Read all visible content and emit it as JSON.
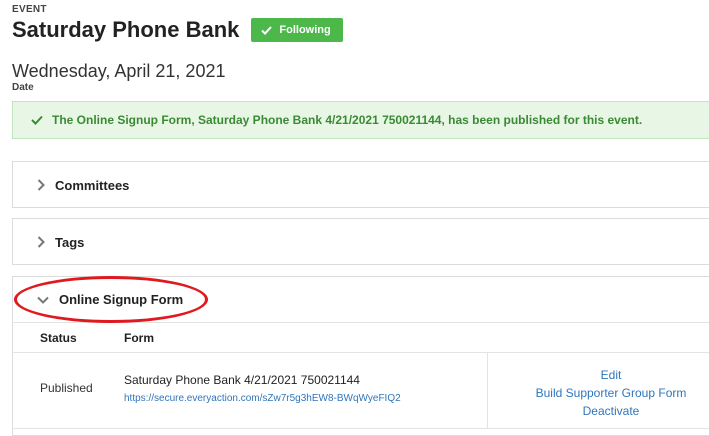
{
  "event": {
    "eyebrow": "EVENT",
    "title": "Saturday Phone Bank",
    "follow_button": "Following",
    "date_value": "Wednesday, April 21, 2021",
    "date_label": "Date"
  },
  "alert": {
    "message": "The Online Signup Form, Saturday Phone Bank 4/21/2021 750021144, has been published for this event."
  },
  "panels": {
    "committees": "Committees",
    "tags": "Tags",
    "signup": "Online Signup Form"
  },
  "signup_table": {
    "headers": {
      "status": "Status",
      "form": "Form"
    },
    "rows": [
      {
        "status": "Published",
        "form_name": "Saturday Phone Bank 4/21/2021 750021144",
        "form_url": "https://secure.everyaction.com/sZw7r5g3hEW8-BWqWyeFIQ2",
        "actions": [
          "Edit",
          "Build Supporter Group Form",
          "Deactivate"
        ]
      }
    ]
  },
  "icons": {
    "check": "check-icon",
    "chevron_right": "chevron-right-icon",
    "chevron_down": "chevron-down-icon"
  },
  "colors": {
    "success_green": "#4cb84a",
    "alert_bg": "#e7f6e5",
    "alert_text": "#3a8a34",
    "link_blue": "#2f76bb",
    "annotation_red": "#e0191f"
  }
}
